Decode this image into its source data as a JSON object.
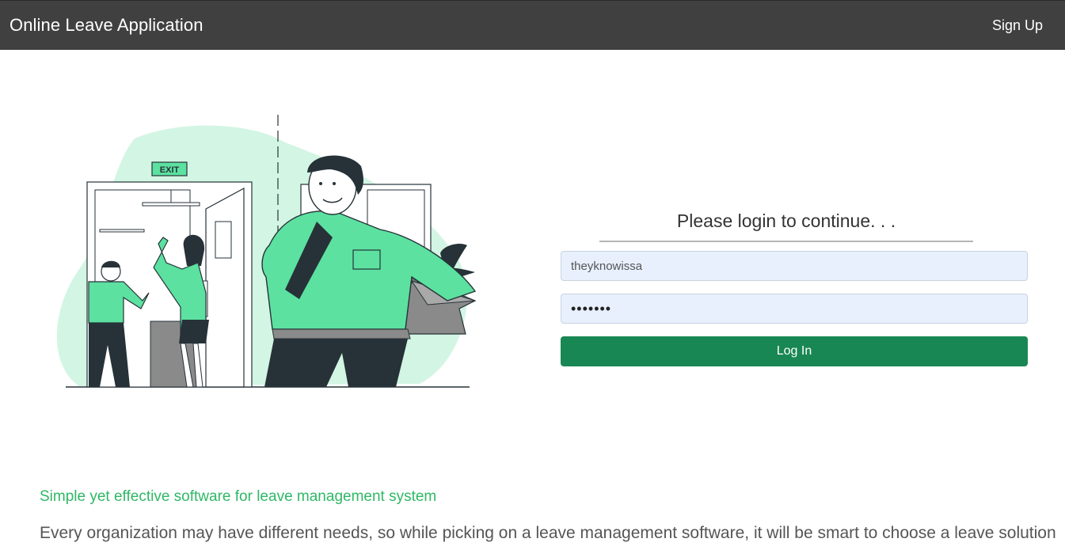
{
  "navbar": {
    "brand": "Online Leave Application",
    "signup_label": "Sign Up"
  },
  "illustration": {
    "exit_sign": "EXIT"
  },
  "login": {
    "title": "Please login to continue. . .",
    "username_value": "theyknowissa",
    "password_value": "•••••••",
    "button_label": "Log In"
  },
  "about": {
    "tagline": "Simple yet effective software for leave management system",
    "description": "Every organization may have different needs, so while picking on a leave management software, it will be smart to choose a leave solution"
  },
  "colors": {
    "navbar_bg": "#404040",
    "accent_green": "#198754",
    "tagline_green": "#2fb866",
    "input_bg": "#e8f0fe",
    "blob": "#d3f5e4",
    "shirt": "#5ce1a0"
  }
}
